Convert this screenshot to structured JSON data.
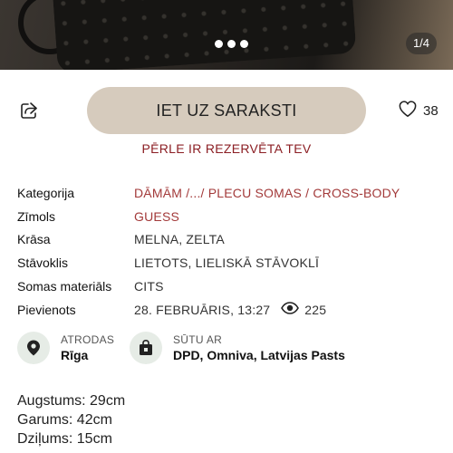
{
  "gallery": {
    "counter": "1/4",
    "dot_count": 3
  },
  "actions": {
    "main_button_label": "IET UZ SARAKSTI",
    "favorites_count": "38",
    "share_icon": "share-icon",
    "heart_icon": "heart-icon"
  },
  "status": {
    "reserved_text": "PĒRLE IR REZERVĒTA TEV"
  },
  "details": {
    "category": {
      "label": "Kategorija",
      "value": "DĀMĀM /.../ PLECU SOMAS / CROSS-BODY"
    },
    "brand": {
      "label": "Zīmols",
      "value": "GUESS"
    },
    "color": {
      "label": "Krāsa",
      "value": "MELNA, ZELTA"
    },
    "condition": {
      "label": "Stāvoklis",
      "value": "LIETOTS, LIELISKĀ STĀVOKLĪ"
    },
    "material": {
      "label": "Somas materiāls",
      "value": "CITS"
    },
    "added": {
      "label": "Pievienots",
      "value": "28. FEBRUĀRIS, 13:27",
      "views": "225"
    }
  },
  "location": {
    "label": "ATRODAS",
    "value": "Rīga"
  },
  "shipping": {
    "label": "SŪTU AR",
    "value": "DPD, Omniva, Latvijas Pasts"
  },
  "description": {
    "lines": [
      "Augstums: 29cm",
      "Garums: 42cm",
      "Dziļums: 15cm"
    ]
  },
  "colors": {
    "accent": "#8b1e23",
    "link": "#a33a3a",
    "button": "#d6cbbd",
    "icon_bg": "#e6ece6"
  }
}
